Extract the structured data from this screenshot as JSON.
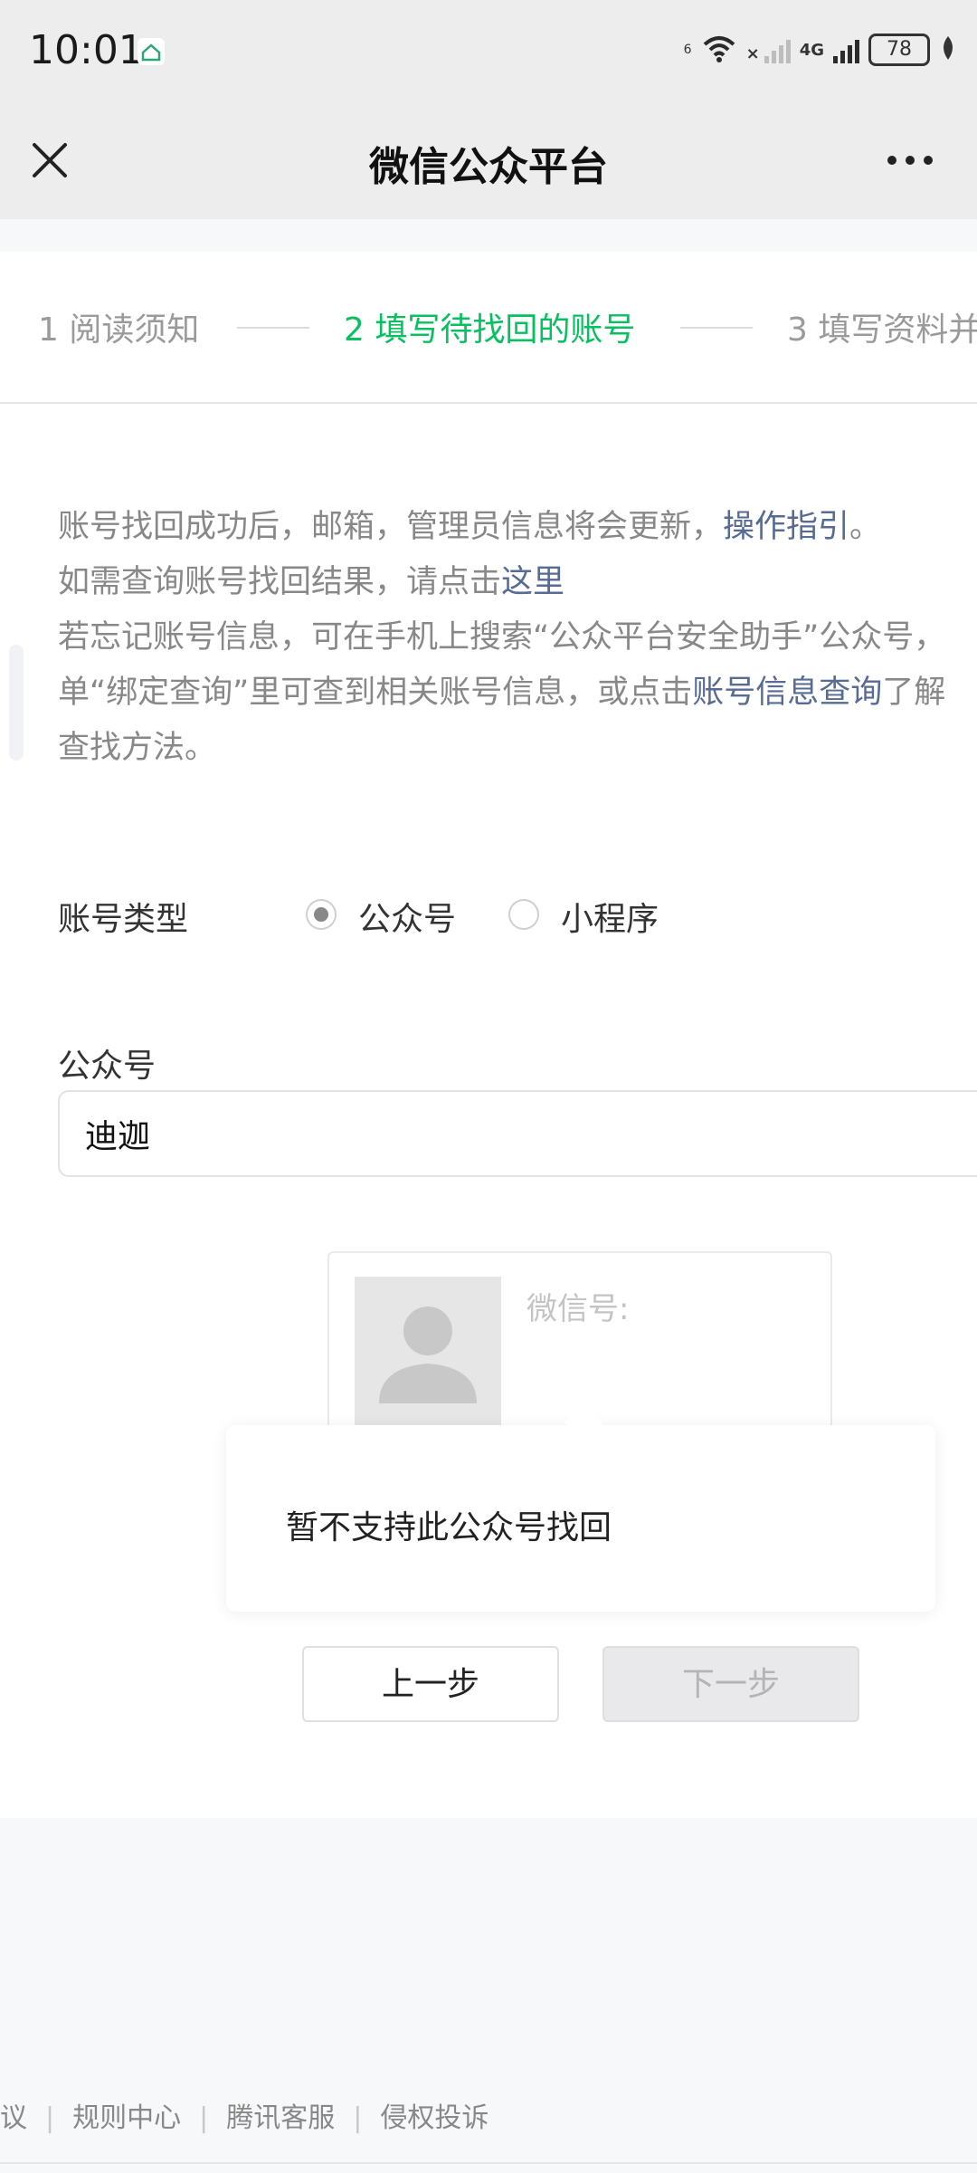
{
  "status_bar": {
    "time": "10:01",
    "wifi_badge": "6",
    "network": "4G",
    "battery": "78",
    "icons": [
      "app-notification-icon",
      "wifi-icon",
      "no-signal-icon",
      "signal-icon",
      "battery-icon",
      "leaf-icon"
    ]
  },
  "nav": {
    "title": "微信公众平台",
    "close_icon": "close-icon",
    "more_icon": "more-icon"
  },
  "steps": {
    "items": [
      "1 阅读须知",
      "2 填写待找回的账号",
      "3 填写资料并"
    ],
    "active_index": 1,
    "active_color": "#07c160"
  },
  "notice": {
    "line1_text": "账号找回成功后，邮箱，管理员信息将会更新，",
    "line1_link": "操作指引",
    "line1_end": "。",
    "line2_text": "如需查询账号找回结果，请点击",
    "line2_link": "这里",
    "line3_text": "若忘记账号信息，可在手机上搜索“公众平台安全助手”公众号，",
    "line4_text": "单“绑定查询”里可查到相关账号信息，或点击",
    "line4_link": "账号信息查询",
    "line4_end": "了解",
    "line5_text": "查找方法。",
    "link_color": "#576b95"
  },
  "account_type": {
    "label": "账号类型",
    "options": [
      {
        "label": "公众号",
        "checked": true
      },
      {
        "label": "小程序",
        "checked": false
      }
    ]
  },
  "official_account": {
    "label": "公众号",
    "value": "迪迦"
  },
  "profile_card": {
    "wechat_id_label": "微信号:",
    "avatar_icon": "default-avatar-icon"
  },
  "popup": {
    "message": "暂不支持此公众号找回"
  },
  "buttons": {
    "prev": "上一步",
    "next": "下一步"
  },
  "footer": {
    "links": [
      "议",
      "规则中心",
      "腾讯客服",
      "侵权投诉"
    ]
  }
}
